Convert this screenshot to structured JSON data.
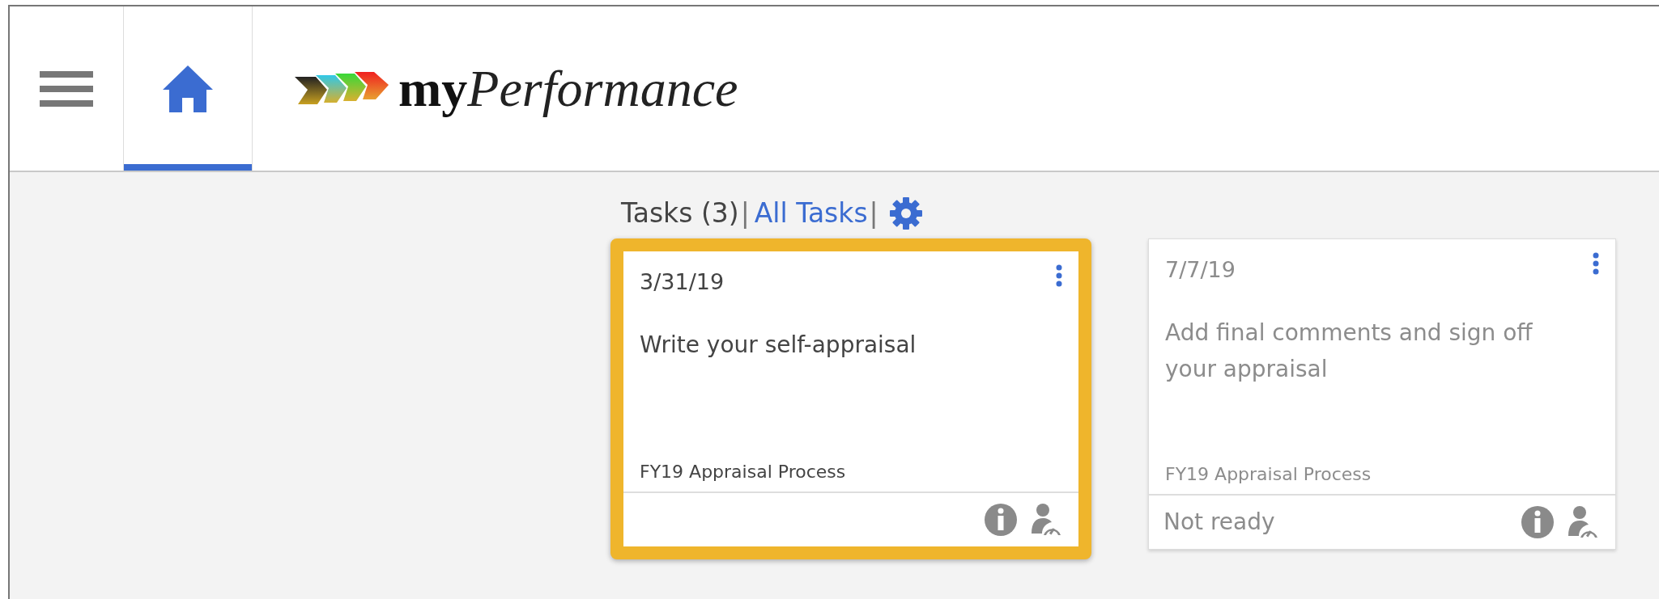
{
  "header": {
    "tabs": [
      {
        "kind": "home",
        "selected": true
      }
    ],
    "logo": "**my**Performance"
  },
  "tasks_bar": {
    "title": "Tasks (3)",
    "separator_1": "|",
    "link": "All Tasks",
    "separator_2": "|"
  },
  "cards": [
    {
      "date": "3/31/19",
      "title": "Write your self-appraisal",
      "process": "FY19 Appraisal Process",
      "highlighted": true,
      "disabled": false
    },
    {
      "date": "7/7/19",
      "title": "Add final comments and sign off your appraisal",
      "process": "FY19 Appraisal Process",
      "status": "Not ready",
      "highlighted": false,
      "disabled": true
    }
  ]
}
